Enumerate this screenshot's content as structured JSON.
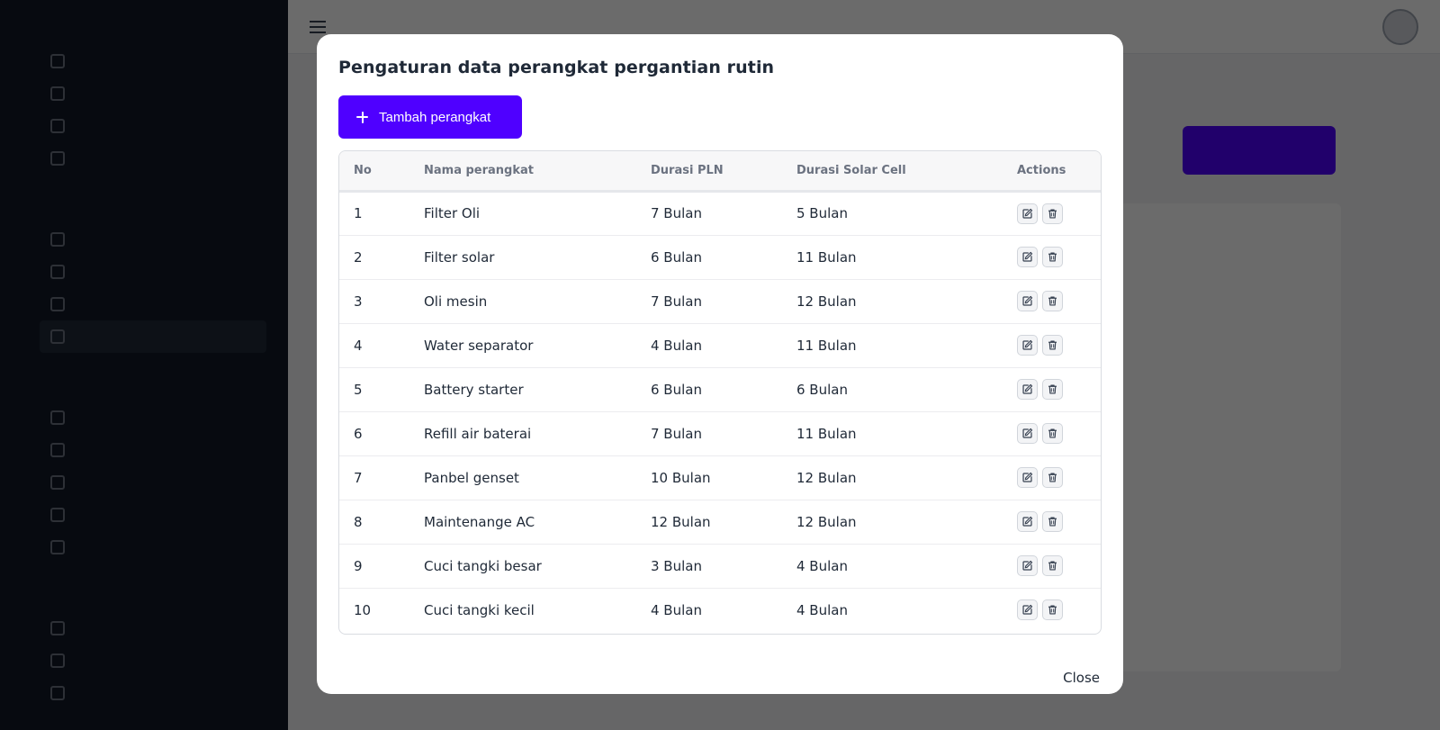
{
  "modal": {
    "title": "Pengaturan data perangkat pergantian rutin",
    "add_button_label": "Tambah perangkat",
    "close_label": "Close",
    "columns": [
      "No",
      "Nama perangkat",
      "Durasi PLN",
      "Durasi Solar Cell",
      "Actions"
    ],
    "rows": [
      {
        "no": "1",
        "name": "Filter Oli",
        "pln": "7 Bulan",
        "solar": "5 Bulan"
      },
      {
        "no": "2",
        "name": "Filter solar",
        "pln": "6 Bulan",
        "solar": "11 Bulan"
      },
      {
        "no": "3",
        "name": "Oli mesin",
        "pln": "7 Bulan",
        "solar": "12 Bulan"
      },
      {
        "no": "4",
        "name": "Water separator",
        "pln": "4 Bulan",
        "solar": "11 Bulan"
      },
      {
        "no": "5",
        "name": "Battery starter",
        "pln": "6 Bulan",
        "solar": "6 Bulan"
      },
      {
        "no": "6",
        "name": "Refill air baterai",
        "pln": "7 Bulan",
        "solar": "11 Bulan"
      },
      {
        "no": "7",
        "name": "Panbel genset",
        "pln": "10 Bulan",
        "solar": "12 Bulan"
      },
      {
        "no": "8",
        "name": "Maintenange AC",
        "pln": "12 Bulan",
        "solar": "12 Bulan"
      },
      {
        "no": "9",
        "name": "Cuci tangki besar",
        "pln": "3 Bulan",
        "solar": "4 Bulan"
      },
      {
        "no": "10",
        "name": "Cuci tangki kecil",
        "pln": "4 Bulan",
        "solar": "4 Bulan"
      }
    ],
    "icons": {
      "add": "plus-icon",
      "edit": "edit-icon",
      "delete": "trash-icon"
    }
  },
  "colors": {
    "accent": "#4f00ff",
    "sidebar": "#111827",
    "overlay": "rgba(0,0,0,0.58)"
  }
}
